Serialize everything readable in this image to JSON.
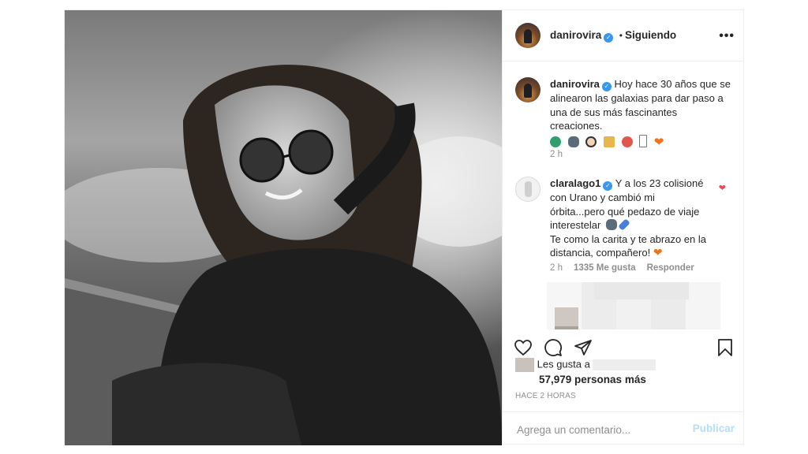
{
  "post": {
    "author": "danirovira",
    "follow_status": "Siguiendo",
    "separator": "•",
    "more_glyph": "•••",
    "verified_glyph": "✓",
    "caption": {
      "username": "danirovira",
      "text": "Hoy hace 30 años que se alinearon las galaxias para dar paso a una de sus más fascinantes creaciones.",
      "emojis": [
        "globe",
        "ufo",
        "woman-face",
        "rocket",
        "balloon",
        "box",
        "orange-heart"
      ],
      "time": "2 h"
    },
    "comment": {
      "username": "claralago1",
      "text_line1": "Y a los 23 colisioné con Urano y cambió mi órbita...pero qué pedazo de viaje interestelar",
      "text_line2": "Te como la carita y te abrazo en la distancia, compañero!",
      "time": "2 h",
      "likes": "1335 Me gusta",
      "reply": "Responder"
    },
    "likes_prefix": "Les gusta a",
    "likes_count": "57,979 personas más",
    "posted_ago": "HACE 2 HORAS",
    "comment_placeholder": "Agrega un comentario...",
    "publish_label": "Publicar"
  },
  "colors": {
    "verified": "#3897f0",
    "like_heart": "#ed4956",
    "publish_disabled": "#b2dffc",
    "muted": "#8e8e8e"
  },
  "icons": [
    "more-options-icon",
    "verified-icon",
    "heart-icon",
    "comment-icon",
    "share-icon",
    "bookmark-icon",
    "comment-like-icon"
  ]
}
